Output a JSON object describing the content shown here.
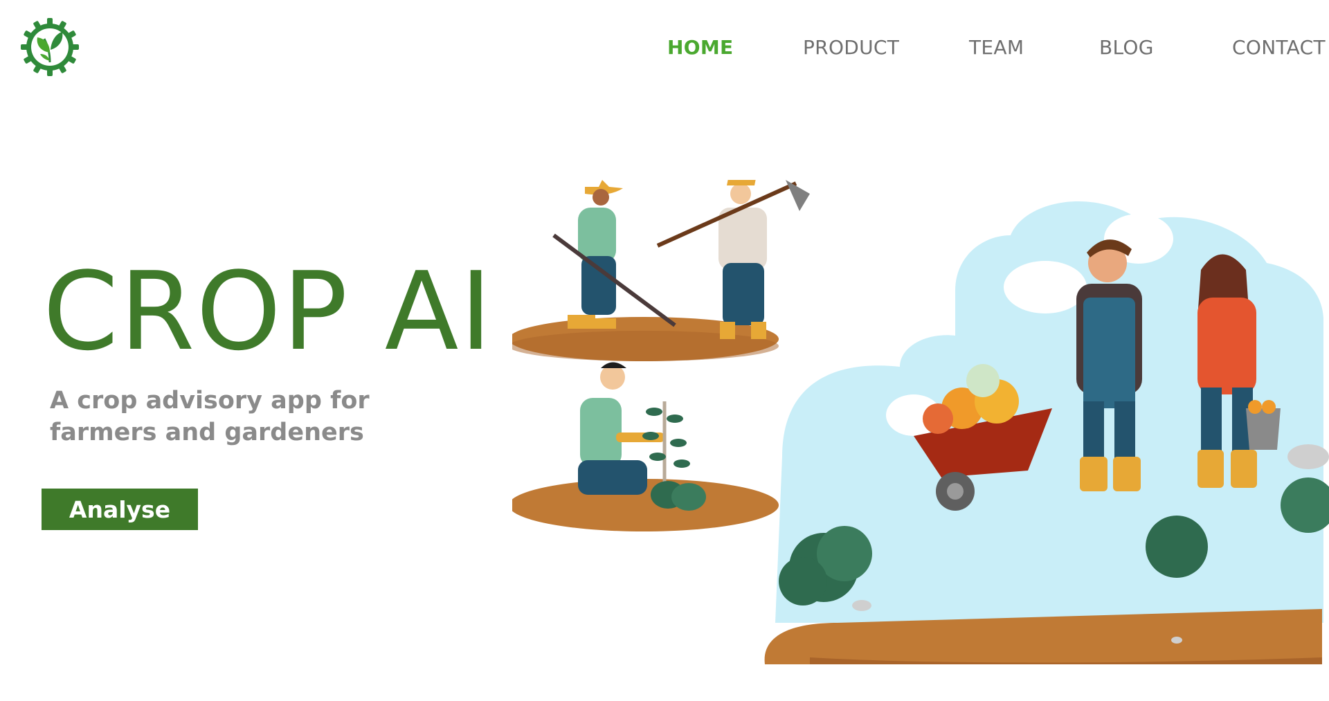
{
  "header": {
    "logo_icon": "leaf-gear-logo",
    "nav": [
      {
        "label": "HOME",
        "active": true
      },
      {
        "label": "PRODUCT",
        "active": false
      },
      {
        "label": "TEAM",
        "active": false
      },
      {
        "label": "BLOG",
        "active": false
      },
      {
        "label": "CONTACT",
        "active": false
      }
    ]
  },
  "hero": {
    "title": "CROP AI",
    "subtitle": "A crop advisory app for farmers and gardeners",
    "button_label": "Analyse"
  },
  "colors": {
    "brand_green": "#3f7a2a",
    "nav_active": "#4aa82f",
    "nav_inactive": "#6e6e6e",
    "subtitle": "#8a8a8a",
    "sky": "#c9eef8",
    "soil": "#c07a35"
  },
  "illustration": {
    "icon": "farmers-illustration"
  }
}
